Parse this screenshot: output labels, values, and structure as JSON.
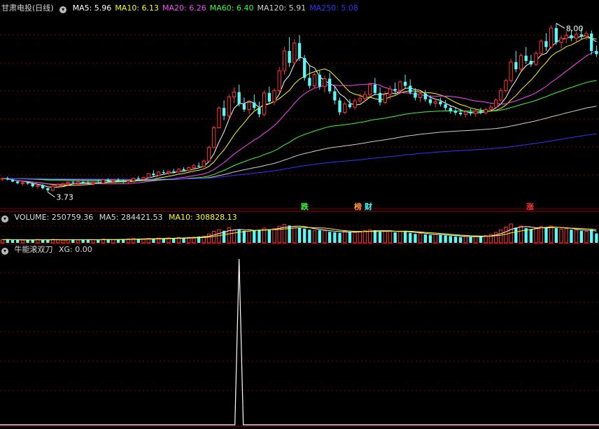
{
  "price_panel": {
    "title": "甘肃电投(日线)",
    "ma_labels": [
      {
        "text": "MA5: 5.96",
        "color": "#ffffff"
      },
      {
        "text": "MA10: 6.13",
        "color": "#ffff00"
      },
      {
        "text": "MA20: 6.26",
        "color": "#ff44ff"
      },
      {
        "text": "MA60: 6.40",
        "color": "#33ff33"
      },
      {
        "text": "MA120: 5.91",
        "color": "#cfcfcf"
      },
      {
        "text": "MA250: 5.08",
        "color": "#3333ff"
      }
    ],
    "high_label": "8.00",
    "low_label": "3.73",
    "events": [
      {
        "text": "跌",
        "color": "#33ff33"
      },
      {
        "text": "榜",
        "color": "#ff9933"
      },
      {
        "text": "财",
        "color": "#33ffff"
      },
      {
        "text": "涨",
        "color": "#ff3333"
      }
    ]
  },
  "volume_panel": {
    "label_volume": "VOLUME: 250759.36",
    "label_ma5": "MA5: 284421.53",
    "label_ma10": "MA10: 308828.13"
  },
  "indicator_panel": {
    "label_name": "牛能滚双刀",
    "label_xg": "XG: 0.00"
  },
  "colors": {
    "up": "#ff3232",
    "down": "#54fcfc",
    "bg": "#000000"
  },
  "chart_data": {
    "type": "candlestick",
    "candles": [
      [
        4.06,
        4.1,
        4.02,
        4.08
      ],
      [
        4.08,
        4.12,
        4.03,
        4.05
      ],
      [
        4.05,
        4.07,
        3.98,
        4.0
      ],
      [
        4.0,
        4.02,
        3.93,
        3.96
      ],
      [
        3.96,
        3.99,
        3.9,
        3.97
      ],
      [
        3.97,
        4.0,
        3.92,
        3.95
      ],
      [
        3.95,
        3.97,
        3.85,
        3.88
      ],
      [
        3.88,
        3.92,
        3.82,
        3.9
      ],
      [
        3.9,
        3.93,
        3.8,
        3.83
      ],
      [
        3.83,
        3.85,
        3.73,
        3.78
      ],
      [
        3.78,
        3.9,
        3.76,
        3.88
      ],
      [
        3.88,
        3.95,
        3.84,
        3.92
      ],
      [
        3.92,
        3.97,
        3.88,
        3.95
      ],
      [
        3.95,
        4.0,
        3.91,
        3.98
      ],
      [
        3.98,
        4.02,
        3.93,
        3.96
      ],
      [
        3.96,
        4.01,
        3.92,
        3.99
      ],
      [
        3.99,
        4.03,
        3.94,
        3.97
      ],
      [
        3.97,
        4.02,
        3.92,
        3.95
      ],
      [
        3.95,
        4.0,
        3.9,
        3.98
      ],
      [
        3.98,
        4.04,
        3.94,
        3.96
      ],
      [
        3.96,
        4.06,
        3.94,
        4.04
      ],
      [
        4.04,
        4.08,
        3.98,
        4.0
      ],
      [
        4.0,
        4.06,
        3.97,
        4.03
      ],
      [
        4.03,
        4.09,
        4.0,
        4.01
      ],
      [
        4.01,
        4.05,
        3.96,
        3.99
      ],
      [
        3.99,
        4.03,
        3.94,
        4.02
      ],
      [
        4.02,
        4.1,
        4.0,
        4.08
      ],
      [
        4.08,
        4.14,
        4.04,
        4.06
      ],
      [
        4.06,
        4.12,
        4.02,
        4.1
      ],
      [
        4.1,
        4.22,
        4.08,
        4.2
      ],
      [
        4.2,
        4.28,
        4.12,
        4.16
      ],
      [
        4.16,
        4.26,
        4.14,
        4.24
      ],
      [
        4.24,
        4.3,
        4.18,
        4.22
      ],
      [
        4.22,
        4.28,
        4.17,
        4.26
      ],
      [
        4.26,
        4.32,
        4.2,
        4.24
      ],
      [
        4.24,
        4.34,
        4.22,
        4.31
      ],
      [
        4.31,
        4.36,
        4.25,
        4.28
      ],
      [
        4.28,
        4.38,
        4.26,
        4.35
      ],
      [
        4.35,
        4.45,
        4.3,
        4.4
      ],
      [
        4.4,
        4.48,
        4.34,
        4.38
      ],
      [
        4.38,
        4.55,
        4.36,
        4.52
      ],
      [
        4.52,
        4.9,
        4.5,
        4.86
      ],
      [
        4.86,
        5.4,
        4.84,
        5.36
      ],
      [
        5.36,
        5.9,
        5.34,
        5.86
      ],
      [
        5.86,
        6.05,
        5.55,
        5.66
      ],
      [
        5.66,
        6.2,
        5.6,
        6.14
      ],
      [
        6.14,
        6.38,
        5.98,
        6.26
      ],
      [
        6.26,
        6.45,
        5.9,
        5.96
      ],
      [
        5.96,
        6.12,
        5.76,
        5.82
      ],
      [
        5.82,
        6.04,
        5.7,
        6.0
      ],
      [
        6.0,
        6.2,
        5.8,
        5.86
      ],
      [
        5.86,
        6.02,
        5.62,
        5.7
      ],
      [
        5.7,
        6.3,
        5.65,
        6.24
      ],
      [
        6.24,
        6.4,
        5.96,
        6.02
      ],
      [
        6.02,
        6.36,
        5.94,
        6.3
      ],
      [
        6.3,
        6.9,
        6.25,
        6.8
      ],
      [
        6.8,
        7.4,
        6.7,
        7.3
      ],
      [
        7.3,
        7.65,
        6.9,
        7.0
      ],
      [
        7.0,
        7.6,
        6.95,
        7.5
      ],
      [
        7.5,
        7.7,
        7.05,
        7.12
      ],
      [
        7.12,
        7.2,
        6.55,
        6.62
      ],
      [
        6.62,
        6.95,
        6.35,
        6.42
      ],
      [
        6.42,
        6.75,
        6.36,
        6.7
      ],
      [
        6.7,
        6.8,
        6.32,
        6.4
      ],
      [
        6.4,
        6.68,
        6.25,
        6.6
      ],
      [
        6.6,
        6.75,
        6.22,
        6.28
      ],
      [
        6.28,
        6.4,
        5.95,
        6.05
      ],
      [
        6.05,
        6.12,
        5.68,
        5.75
      ],
      [
        5.75,
        6.02,
        5.7,
        5.96
      ],
      [
        5.96,
        6.08,
        5.84,
        5.88
      ],
      [
        5.88,
        6.1,
        5.82,
        6.04
      ],
      [
        6.04,
        6.22,
        5.98,
        6.1
      ],
      [
        6.1,
        6.28,
        6.02,
        6.2
      ],
      [
        6.2,
        6.5,
        6.15,
        6.45
      ],
      [
        6.45,
        6.62,
        6.18,
        6.24
      ],
      [
        6.24,
        6.38,
        5.92,
        6.0
      ],
      [
        6.0,
        6.28,
        5.96,
        6.2
      ],
      [
        6.2,
        6.42,
        6.08,
        6.34
      ],
      [
        6.34,
        6.5,
        6.22,
        6.3
      ],
      [
        6.3,
        6.56,
        6.25,
        6.52
      ],
      [
        6.52,
        6.7,
        6.35,
        6.42
      ],
      [
        6.42,
        6.58,
        6.2,
        6.25
      ],
      [
        6.25,
        6.36,
        6.05,
        6.12
      ],
      [
        6.12,
        6.28,
        6.0,
        6.22
      ],
      [
        6.22,
        6.32,
        6.02,
        6.08
      ],
      [
        6.08,
        6.18,
        5.92,
        5.98
      ],
      [
        5.98,
        6.1,
        5.88,
        6.02
      ],
      [
        6.02,
        6.12,
        5.9,
        5.95
      ],
      [
        5.95,
        6.06,
        5.8,
        5.86
      ],
      [
        5.86,
        5.92,
        5.72,
        5.78
      ],
      [
        5.78,
        5.86,
        5.68,
        5.74
      ],
      [
        5.74,
        5.84,
        5.66,
        5.7
      ],
      [
        5.7,
        5.8,
        5.62,
        5.76
      ],
      [
        5.76,
        5.84,
        5.66,
        5.72
      ],
      [
        5.72,
        5.82,
        5.64,
        5.78
      ],
      [
        5.78,
        5.86,
        5.7,
        5.74
      ],
      [
        5.74,
        5.86,
        5.7,
        5.82
      ],
      [
        5.82,
        5.94,
        5.76,
        5.88
      ],
      [
        5.88,
        6.1,
        5.84,
        6.06
      ],
      [
        6.06,
        6.36,
        6.02,
        6.3
      ],
      [
        6.3,
        6.6,
        6.25,
        6.55
      ],
      [
        6.55,
        7.1,
        6.5,
        7.02
      ],
      [
        7.02,
        7.3,
        6.76,
        6.84
      ],
      [
        6.84,
        7.24,
        6.8,
        7.18
      ],
      [
        7.18,
        7.4,
        6.98,
        7.05
      ],
      [
        7.05,
        7.2,
        6.9,
        6.96
      ],
      [
        6.96,
        7.3,
        6.92,
        7.24
      ],
      [
        7.24,
        7.6,
        7.2,
        7.55
      ],
      [
        7.55,
        7.75,
        7.3,
        7.4
      ],
      [
        7.4,
        7.95,
        7.36,
        7.88
      ],
      [
        7.88,
        8.0,
        7.45,
        7.52
      ],
      [
        7.52,
        7.7,
        7.36,
        7.62
      ],
      [
        7.62,
        7.8,
        7.5,
        7.7
      ],
      [
        7.7,
        7.84,
        7.55,
        7.62
      ],
      [
        7.62,
        7.78,
        7.52,
        7.72
      ],
      [
        7.72,
        7.88,
        7.6,
        7.68
      ],
      [
        7.68,
        7.8,
        7.58,
        7.74
      ],
      [
        7.74,
        7.82,
        7.2,
        7.3
      ],
      [
        7.3,
        7.44,
        7.15,
        7.22
      ]
    ],
    "volume": [
      12,
      13,
      11,
      12,
      10,
      11,
      12,
      13,
      12,
      11,
      13,
      12,
      11,
      12,
      13,
      11,
      12,
      13,
      12,
      11,
      14,
      13,
      12,
      13,
      14,
      15,
      16,
      14,
      15,
      17,
      16,
      18,
      17,
      19,
      18,
      20,
      19,
      21,
      22,
      24,
      26,
      34,
      44,
      50,
      46,
      58,
      48,
      52,
      46,
      44,
      46,
      50,
      56,
      52,
      54,
      62,
      70,
      66,
      62,
      58,
      54,
      50,
      46,
      48,
      46,
      42,
      40,
      38,
      44,
      42,
      40,
      44,
      46,
      50,
      48,
      42,
      44,
      46,
      40,
      44,
      42,
      38,
      34,
      36,
      32,
      30,
      32,
      30,
      28,
      26,
      24,
      22,
      24,
      22,
      26,
      24,
      28,
      32,
      40,
      50,
      60,
      72,
      58,
      64,
      56,
      52,
      56,
      62,
      58,
      64,
      56,
      52,
      54,
      50,
      48,
      46,
      44,
      50,
      36
    ],
    "ylim": [
      3.6,
      8.2
    ],
    "xg_signal_index": 47
  }
}
